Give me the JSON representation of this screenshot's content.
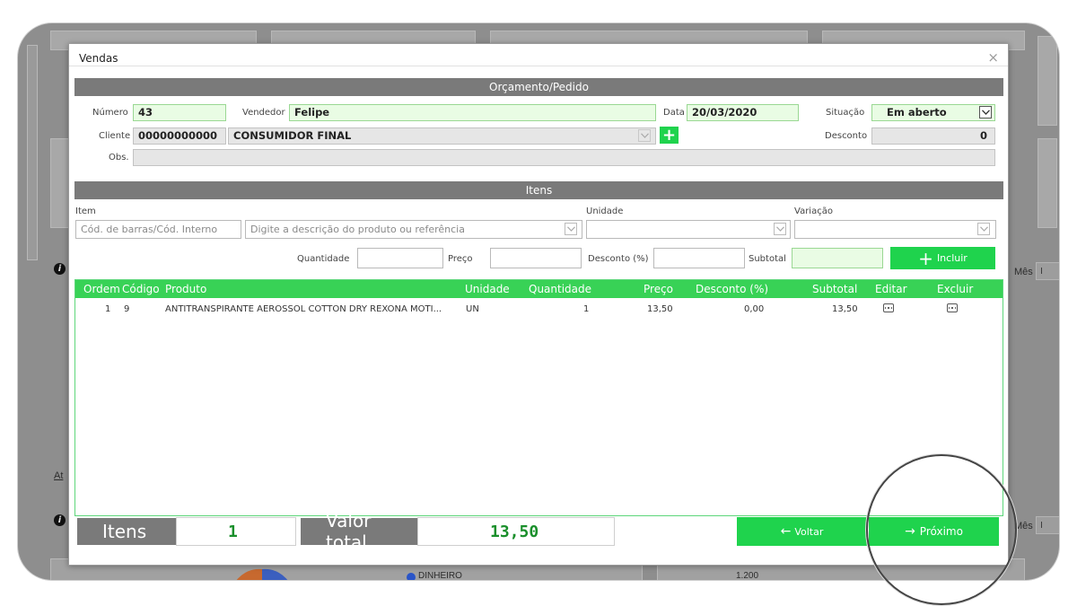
{
  "modal": {
    "title": "Vendas",
    "close": "×"
  },
  "sections": {
    "order": "Orçamento/Pedido",
    "items": "Itens"
  },
  "order": {
    "numero_label": "Número",
    "numero": "43",
    "vendedor_label": "Vendedor",
    "vendedor": "Felipe",
    "data_label": "Data",
    "data": "20/03/2020",
    "situacao_label": "Situação",
    "situacao": "Em aberto",
    "cliente_label": "Cliente",
    "cliente_codigo": "00000000000",
    "cliente_nome": "CONSUMIDOR FINAL",
    "desconto_label": "Desconto",
    "desconto": "0",
    "obs_label": "Obs.",
    "obs": ""
  },
  "item_form": {
    "item_label": "Item",
    "codigo_placeholder": "Cód. de barras/Cód. Interno",
    "descricao_placeholder": "Digite a descrição do produto ou referência",
    "unidade_label": "Unidade",
    "variacao_label": "Variação",
    "quantidade_label": "Quantidade",
    "preco_label": "Preço",
    "desconto_label": "Desconto (%)",
    "subtotal_label": "Subtotal",
    "incluir_label": "Incluir"
  },
  "table": {
    "headers": [
      "Ordem",
      "Código",
      "Produto",
      "Unidade",
      "Quantidade",
      "Preço",
      "Desconto (%)",
      "Subtotal",
      "Editar",
      "Excluir"
    ],
    "rows": [
      {
        "ordem": "1",
        "codigo": "9",
        "produto": "ANTITRANSPIRANTE AEROSSOL COTTON DRY REXONA MOTI...",
        "unidade": "UN",
        "quantidade": "1",
        "preco": "13,50",
        "desconto": "0,00",
        "subtotal": "13,50"
      }
    ]
  },
  "footer": {
    "itens_label": "Itens",
    "itens_value": "1",
    "valor_label": "Valor total",
    "valor_value": "13,50",
    "voltar_label": "Voltar",
    "proximo_label": "Próximo"
  },
  "background": {
    "mes_label_1": "Mês",
    "mes_label_2": "Mês",
    "at_label": "At",
    "dinheiro_label": "DINHEIRO",
    "axis_value": "1.200"
  },
  "colors": {
    "accent": "#1fd34d",
    "header_gray": "#7a7a7a",
    "table_header": "#38d256",
    "value_green": "#1a8f2b"
  }
}
